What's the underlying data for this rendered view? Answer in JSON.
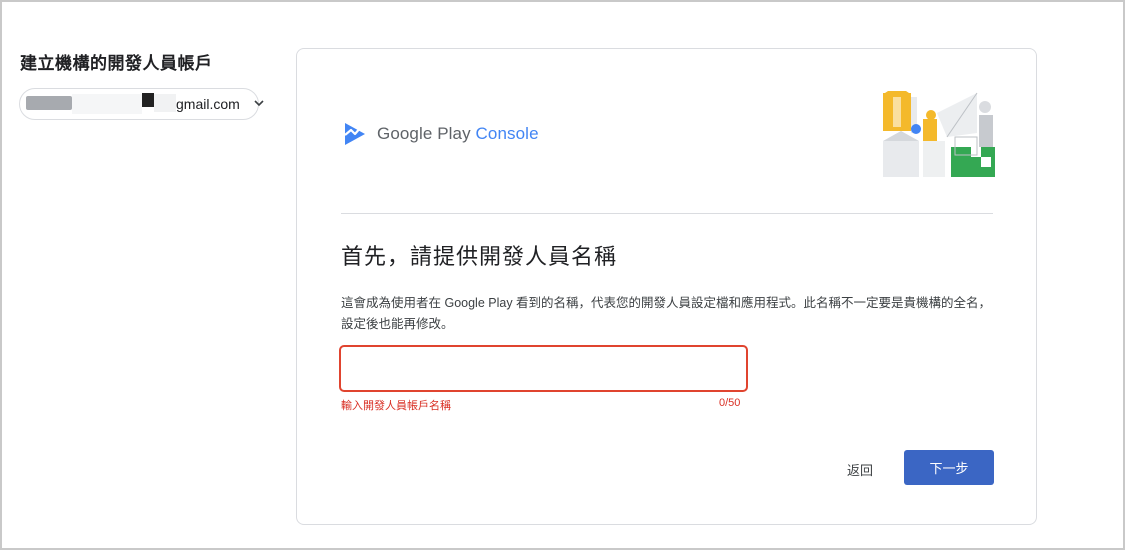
{
  "sidebar": {
    "title": "建立機構的開發人員帳戶",
    "account_email_suffix": "gmail.com"
  },
  "card": {
    "logo": {
      "brand": "Google Play",
      "product": "Console"
    },
    "heading": "首先，請提供開發人員名稱",
    "description": "這會成為使用者在 Google Play 看到的名稱，代表您的開發人員設定檔和應用程式。此名稱不一定要是貴機構的全名，設定後也能再修改。",
    "name_input": {
      "value": "",
      "helper_text": "輸入開發人員帳戶名稱",
      "counter": "0/50"
    },
    "buttons": {
      "back": "返回",
      "next": "下一步"
    }
  },
  "colors": {
    "primary_button": "#3b66c4",
    "error": "#d93025",
    "console_blue": "#4285f4"
  }
}
